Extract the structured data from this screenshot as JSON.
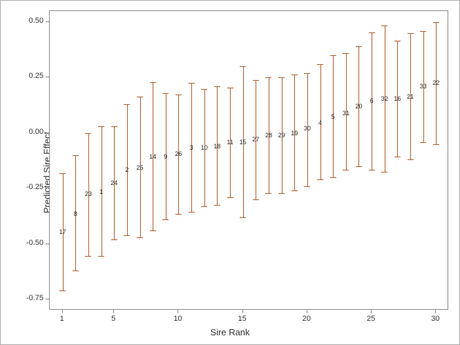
{
  "chart_data": {
    "type": "errorbar",
    "xlabel": "Sire Rank",
    "ylabel": "Predicted Sire Effect",
    "xlim": [
      0,
      31
    ],
    "ylim": [
      -0.8,
      0.55
    ],
    "x_ticks": [
      1,
      5,
      10,
      15,
      20,
      25,
      30
    ],
    "y_ticks": [
      -0.75,
      -0.5,
      -0.25,
      0.0,
      0.25,
      0.5
    ],
    "series": [
      {
        "rank": 1,
        "label": "17",
        "est": -0.445,
        "low": -0.71,
        "high": -0.18
      },
      {
        "rank": 2,
        "label": "8",
        "est": -0.365,
        "low": -0.62,
        "high": -0.1
      },
      {
        "rank": 3,
        "label": "23",
        "est": -0.275,
        "low": -0.555,
        "high": 0.0
      },
      {
        "rank": 4,
        "label": "1",
        "est": -0.265,
        "low": -0.555,
        "high": 0.03
      },
      {
        "rank": 5,
        "label": "24",
        "est": -0.225,
        "low": -0.48,
        "high": 0.03
      },
      {
        "rank": 6,
        "label": "2",
        "est": -0.165,
        "low": -0.46,
        "high": 0.13
      },
      {
        "rank": 7,
        "label": "25",
        "est": -0.155,
        "low": -0.47,
        "high": 0.165
      },
      {
        "rank": 8,
        "label": "14",
        "est": -0.105,
        "low": -0.44,
        "high": 0.23
      },
      {
        "rank": 9,
        "label": "9",
        "est": -0.105,
        "low": -0.39,
        "high": 0.18
      },
      {
        "rank": 10,
        "label": "26",
        "est": -0.095,
        "low": -0.365,
        "high": 0.175
      },
      {
        "rank": 11,
        "label": "3",
        "est": -0.065,
        "low": -0.355,
        "high": 0.225
      },
      {
        "rank": 12,
        "label": "10",
        "est": -0.065,
        "low": -0.33,
        "high": 0.2
      },
      {
        "rank": 13,
        "label": "18",
        "est": -0.06,
        "low": -0.325,
        "high": 0.21
      },
      {
        "rank": 14,
        "label": "11",
        "est": -0.04,
        "low": -0.29,
        "high": 0.205
      },
      {
        "rank": 15,
        "label": "15",
        "est": -0.04,
        "low": -0.38,
        "high": 0.3
      },
      {
        "rank": 16,
        "label": "27",
        "est": -0.03,
        "low": -0.3,
        "high": 0.24
      },
      {
        "rank": 17,
        "label": "28",
        "est": -0.01,
        "low": -0.27,
        "high": 0.25
      },
      {
        "rank": 18,
        "label": "29",
        "est": -0.01,
        "low": -0.27,
        "high": 0.25
      },
      {
        "rank": 19,
        "label": "19",
        "est": 0.0,
        "low": -0.26,
        "high": 0.265
      },
      {
        "rank": 20,
        "label": "30",
        "est": 0.02,
        "low": -0.24,
        "high": 0.27
      },
      {
        "rank": 21,
        "label": "4",
        "est": 0.045,
        "low": -0.21,
        "high": 0.31
      },
      {
        "rank": 22,
        "label": "5",
        "est": 0.075,
        "low": -0.2,
        "high": 0.35
      },
      {
        "rank": 23,
        "label": "31",
        "est": 0.09,
        "low": -0.165,
        "high": 0.36
      },
      {
        "rank": 24,
        "label": "20",
        "est": 0.12,
        "low": -0.15,
        "high": 0.39
      },
      {
        "rank": 25,
        "label": "6",
        "est": 0.145,
        "low": -0.165,
        "high": 0.455
      },
      {
        "rank": 26,
        "label": "32",
        "est": 0.155,
        "low": -0.175,
        "high": 0.485
      },
      {
        "rank": 27,
        "label": "16",
        "est": 0.155,
        "low": -0.105,
        "high": 0.415
      },
      {
        "rank": 28,
        "label": "21",
        "est": 0.165,
        "low": -0.12,
        "high": 0.45
      },
      {
        "rank": 29,
        "label": "33",
        "est": 0.21,
        "low": -0.04,
        "high": 0.46
      },
      {
        "rank": 30,
        "label": "22",
        "est": 0.225,
        "low": -0.05,
        "high": 0.5
      }
    ]
  }
}
